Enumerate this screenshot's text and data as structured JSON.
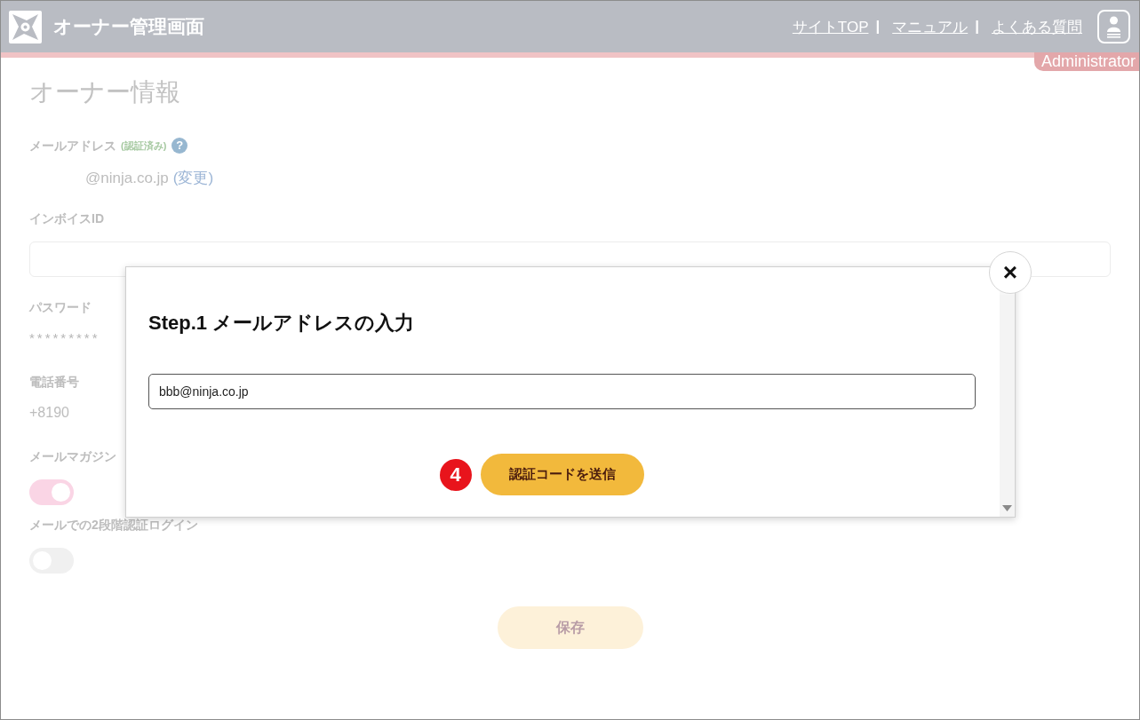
{
  "header": {
    "title": "オーナー管理画面",
    "links": [
      {
        "label": "サイトTOP",
        "separator": "|"
      },
      {
        "label": "マニュアル",
        "separator": "|"
      },
      {
        "label": "よくある質問"
      }
    ],
    "role": "Administrator"
  },
  "page": {
    "title": "オーナー情報",
    "fields": [
      {
        "kind": "email",
        "label": "メールアドレス",
        "note": "(認証済み)",
        "help": "?",
        "value": "@ninja.co.jp",
        "link": "(変更)"
      },
      {
        "kind": "input",
        "label": "インボイスID"
      },
      {
        "kind": "text",
        "label": "パスワード",
        "value": "*********"
      },
      {
        "kind": "text",
        "label": "電話番号",
        "value": "+8190"
      },
      {
        "kind": "toggle",
        "label": "メールマガジン",
        "on": true
      },
      {
        "kind": "toggle",
        "label": "メールでの2段階認証ログイン",
        "on": false
      }
    ],
    "save_button": "保存"
  },
  "modal": {
    "title": "Step.1 メールアドレスの入力",
    "email_field": {
      "value": "bbb@ninja.co.jp"
    },
    "step_marker": "4",
    "submit_button": "認証コードを送信",
    "close": "×"
  }
}
